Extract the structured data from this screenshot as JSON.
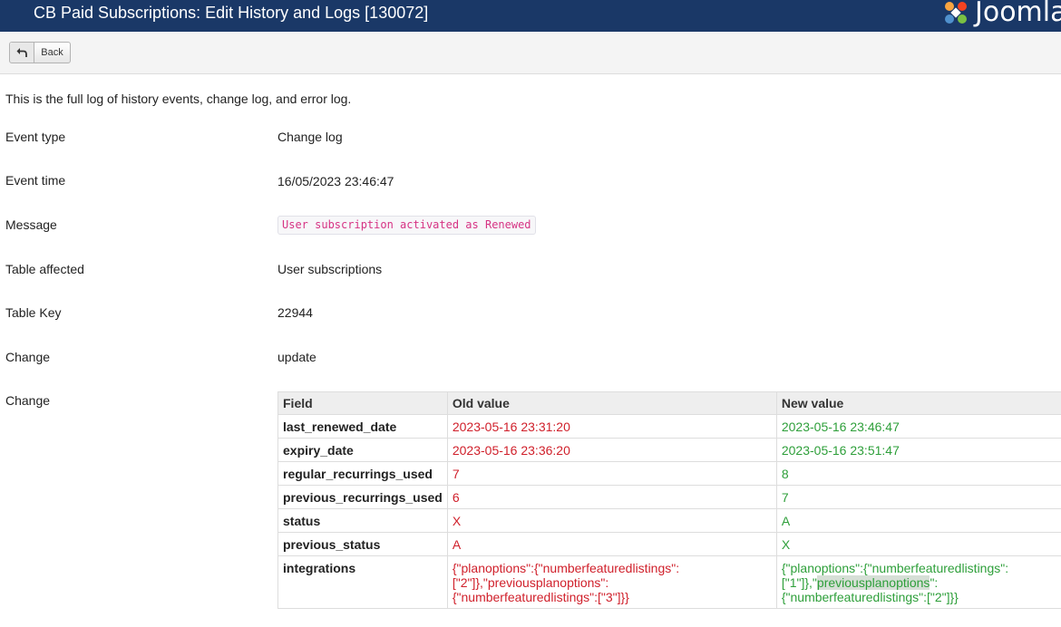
{
  "header": {
    "title": "CB Paid Subscriptions: Edit History and Logs [130072]",
    "logo_text": "Joomla"
  },
  "toolbar": {
    "back_label": "Back"
  },
  "intro": "This is the full log of history events, change log, and error log.",
  "details": {
    "event_type": {
      "label": "Event type",
      "value": "Change log"
    },
    "event_time": {
      "label": "Event time",
      "value": "16/05/2023 23:46:47"
    },
    "message": {
      "label": "Message",
      "value": "User subscription activated as Renewed"
    },
    "table_affected": {
      "label": "Table affected",
      "value": "User subscriptions"
    },
    "table_key": {
      "label": "Table Key",
      "value": "22944"
    },
    "change_type": {
      "label": "Change",
      "value": "update"
    },
    "change_table_label": "Change"
  },
  "changes": {
    "headers": [
      "Field",
      "Old value",
      "New value"
    ],
    "rows": [
      {
        "field": "last_renewed_date",
        "old": "2023-05-16 23:31:20",
        "new": "2023-05-16 23:46:47"
      },
      {
        "field": "expiry_date",
        "old": "2023-05-16 23:36:20",
        "new": "2023-05-16 23:51:47"
      },
      {
        "field": "regular_recurrings_used",
        "old": "7",
        "new": "8"
      },
      {
        "field": "previous_recurrings_used",
        "old": "6",
        "new": "7"
      },
      {
        "field": "status",
        "old": "X",
        "new": "A"
      },
      {
        "field": "previous_status",
        "old": "A",
        "new": "X"
      }
    ],
    "integrations": {
      "field": "integrations",
      "old_lines": [
        "{\"planoptions\":{\"numberfeaturedlistings\":",
        "[\"2\"]},\"previousplanoptions\":",
        "{\"numberfeaturedlistings\":[\"3\"]}}"
      ],
      "new_line1": "{\"planoptions\":{\"numberfeaturedlistings\":",
      "new_line2_a": "[\"1\"]},\"",
      "new_line2_highlight": "previousplanoptions",
      "new_line2_b": "\":",
      "new_line3": "{\"numberfeaturedlistings\":[\"2\"]}}"
    }
  },
  "colors": {
    "header_bg": "#1a3867",
    "old_value": "#d0202b",
    "new_value": "#2e9f3a",
    "code_text": "#d63384"
  },
  "icons": {
    "back": "undo-arrow-icon",
    "logo": "joomla-logo-icon"
  }
}
